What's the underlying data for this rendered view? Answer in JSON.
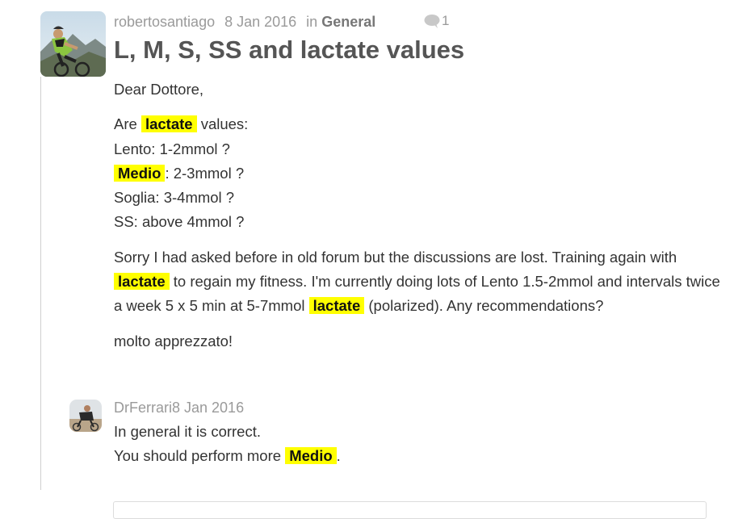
{
  "post": {
    "author": "robertosantiago",
    "date": "8 Jan 2016",
    "in_label": "in",
    "category": "General",
    "comment_count": "1",
    "title": "L, M, S, SS and lactate values",
    "greeting": "Dear Dottore,",
    "lines": {
      "l1_pre": "Are",
      "l1_hl": "lactate",
      "l1_post": "values:",
      "l2": "Lento: 1-2mmol ?",
      "l3_hl": "Medio",
      "l3_post": ": 2-3mmol ?",
      "l4": "Soglia: 3-4mmol ?",
      "l5": "SS: above 4mmol ?"
    },
    "para2": {
      "t1": "Sorry I had asked before in old forum but the discussions are lost. Training again with",
      "hl1": "lactate",
      "t2": "to regain my fitness. I'm currently doing lots of Lento 1.5-2mmol and intervals twice a week 5 x 5 min at 5-7mmol",
      "hl2": "lactate",
      "t3": "(polarized). Any recommendations?"
    },
    "closing": "molto apprezzato!"
  },
  "reply": {
    "author": "DrFerrari",
    "date": "8 Jan 2016",
    "line1": "In general it is correct.",
    "line2_pre": "You should perform more",
    "line2_hl": "Medio",
    "line2_post": "."
  },
  "colors": {
    "highlight": "#ffff00",
    "meta": "#9a9a9a",
    "title": "#555555"
  }
}
